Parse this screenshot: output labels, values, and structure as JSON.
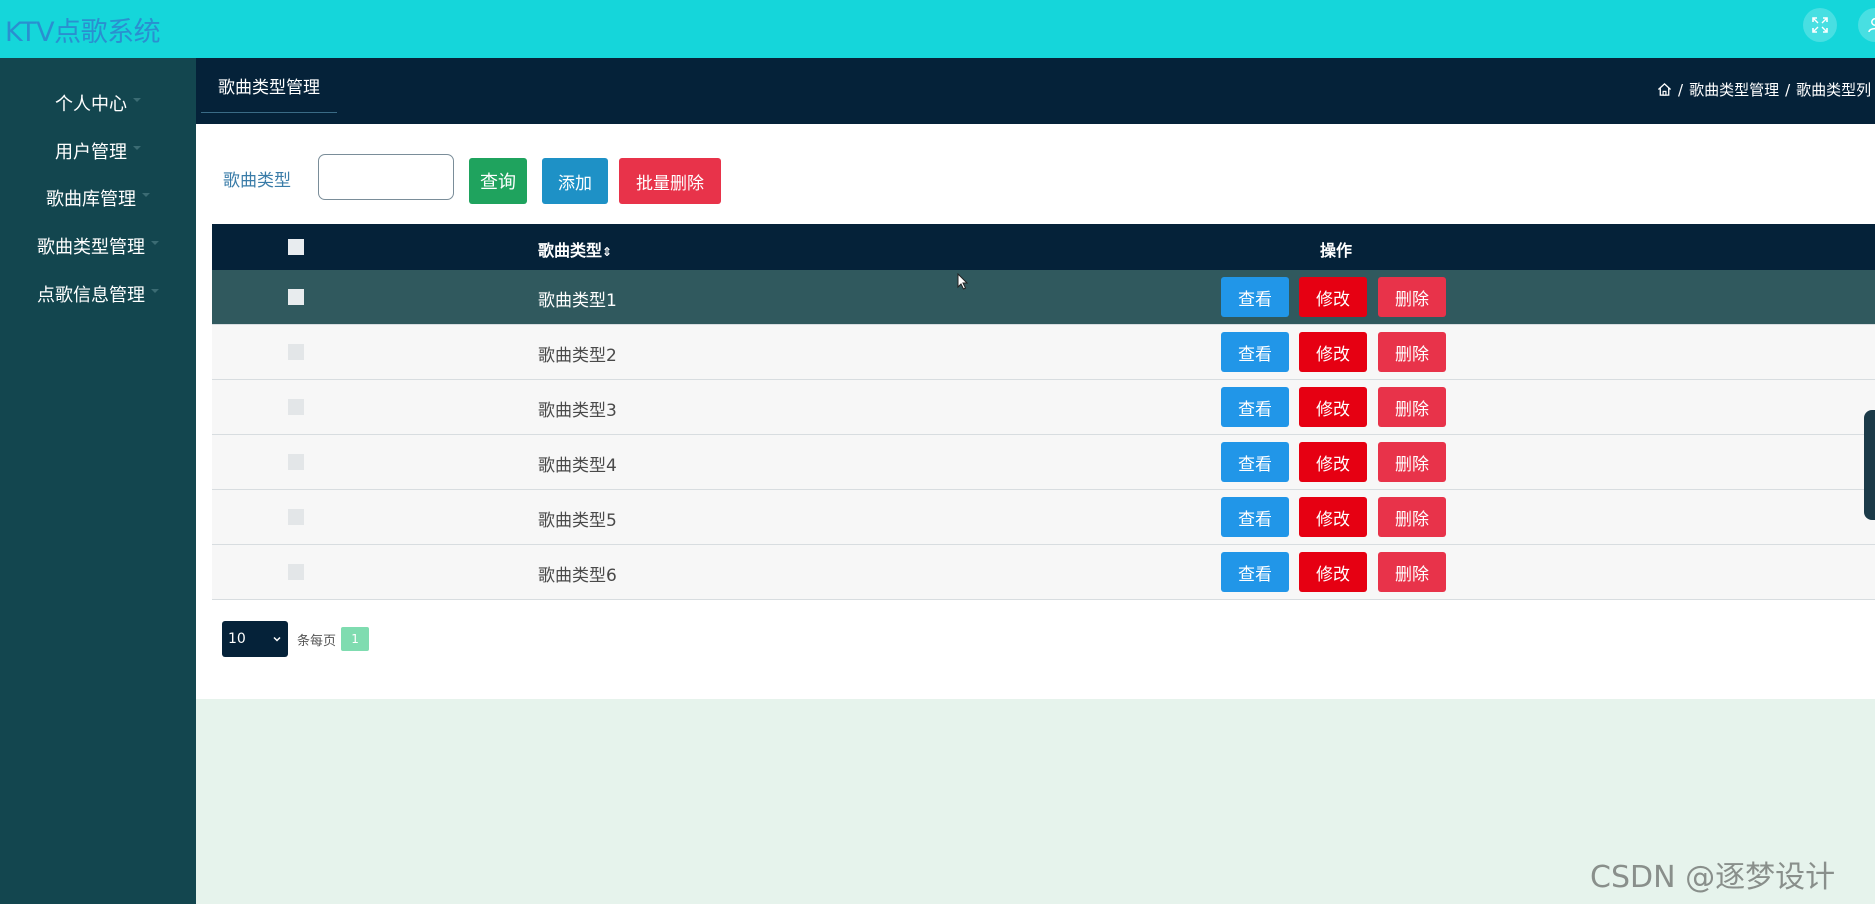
{
  "app": {
    "title": "KTV点歌系统"
  },
  "header": {
    "fullscreen_icon": "fullscreen-expand-icon",
    "user_icon": "user-icon"
  },
  "sidebar": {
    "items": [
      {
        "label": "个人中心"
      },
      {
        "label": "用户管理"
      },
      {
        "label": "歌曲库管理"
      },
      {
        "label": "歌曲类型管理"
      },
      {
        "label": "点歌信息管理"
      }
    ]
  },
  "page": {
    "tab_label": "歌曲类型管理",
    "breadcrumb": [
      "歌曲类型管理",
      "歌曲类型列"
    ]
  },
  "search": {
    "label": "歌曲类型",
    "value": "",
    "query_label": "查询",
    "add_label": "添加",
    "batch_delete_label": "批量删除"
  },
  "table": {
    "columns": [
      "歌曲类型",
      "操作"
    ],
    "sort_icon": "sort-icon",
    "rows": [
      {
        "type": "歌曲类型1"
      },
      {
        "type": "歌曲类型2"
      },
      {
        "type": "歌曲类型3"
      },
      {
        "type": "歌曲类型4"
      },
      {
        "type": "歌曲类型5"
      },
      {
        "type": "歌曲类型6"
      }
    ],
    "actions": {
      "view": "查看",
      "edit": "修改",
      "delete": "删除"
    }
  },
  "pagination": {
    "page_size": "10",
    "per_page_label": "条每页",
    "current_page": "1"
  },
  "watermark": "CSDN @逐梦设计",
  "colors": {
    "topbar": "#15d6da",
    "sidebar": "#13464f",
    "header_dark": "#052239",
    "btn_query": "#1fa35e",
    "btn_add": "#1e91c6",
    "btn_danger": "#e8334a",
    "btn_view": "#2196e8",
    "btn_edit": "#e60012"
  }
}
